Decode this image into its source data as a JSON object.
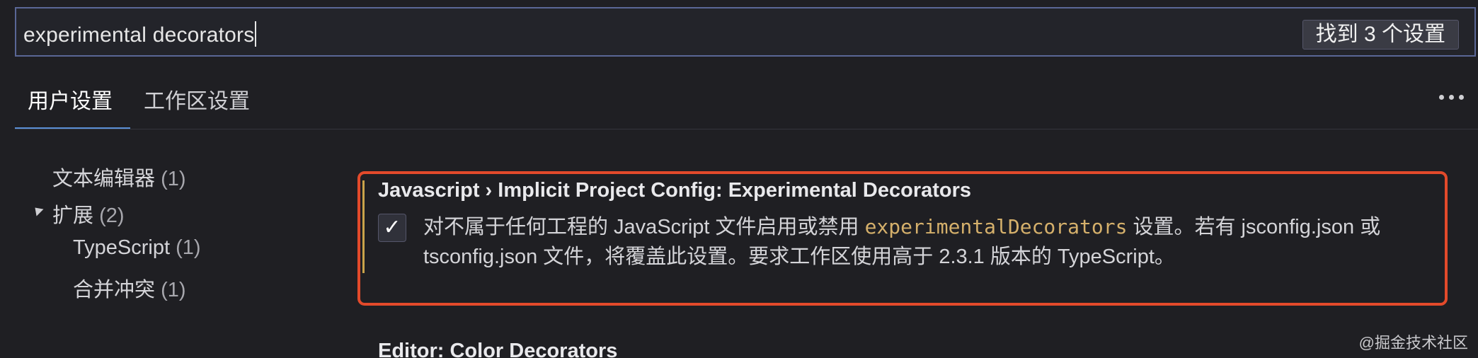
{
  "search": {
    "value": "experimental decorators",
    "result_count_label": "找到 3 个设置"
  },
  "tabs": [
    {
      "label": "用户设置",
      "active": true
    },
    {
      "label": "工作区设置",
      "active": false
    }
  ],
  "more_actions_icon": "more-horizontal-icon",
  "tree": [
    {
      "label": "文本编辑器",
      "count": "(1)"
    },
    {
      "label": "扩展",
      "count": "(2)",
      "expanded": true
    },
    {
      "label": "TypeScript",
      "count": "(1)"
    },
    {
      "label": "合并冲突",
      "count": "(1)"
    }
  ],
  "setting": {
    "title": "Javascript › Implicit Project Config: Experimental Decorators",
    "checked": true,
    "desc_before": "对不属于任何工程的 JavaScript 文件启用或禁用 ",
    "desc_code": "experimentalDecorators",
    "desc_after": " 设置。若有 jsconfig.json 或 tsconfig.json 文件，将覆盖此设置。要求工作区使用高于 2.3.1 版本的 TypeScript。"
  },
  "next_setting": {
    "title": "Editor: Color Decorators"
  },
  "watermark": "@掘金技术社区",
  "colors": {
    "highlight_border": "#e34a2b",
    "modified_indicator": "#caa34a",
    "code_text": "#d5b06b",
    "tab_underline": "#5b8fd6"
  }
}
